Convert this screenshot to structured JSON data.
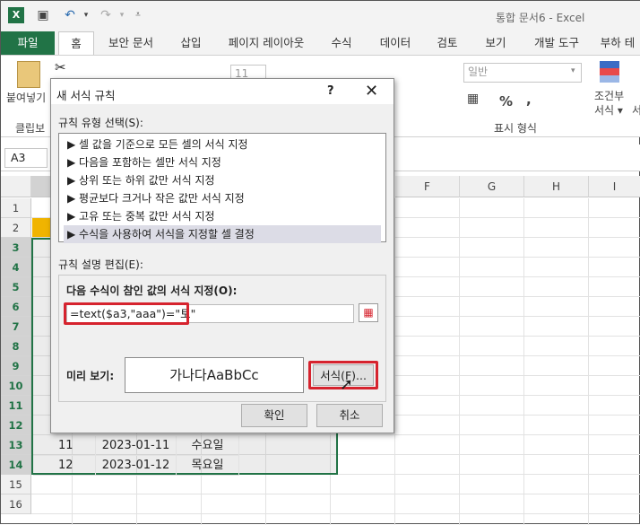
{
  "window": {
    "title": "통합 문서6 - Excel"
  },
  "tabs": [
    "파일",
    "홈",
    "보안 문서",
    "삽입",
    "페이지 레이아웃",
    "수식",
    "데이터",
    "검토",
    "보기",
    "개발 도구",
    "부하 테"
  ],
  "ribbon": {
    "paste_label": "붙여넣기",
    "clipboard_label": "클립보",
    "font_size": "11",
    "number_format": "일반",
    "number_group_label": "표시 형식",
    "conditional_label_1": "조건부",
    "conditional_label_2": "서식 ▾",
    "cell_style_label": "서"
  },
  "formula_bar": {
    "name_box": "A3"
  },
  "columns": [
    "F",
    "G",
    "H",
    "I"
  ],
  "rows": [
    "1",
    "2",
    "3",
    "4",
    "5",
    "6",
    "7",
    "8",
    "9",
    "10",
    "11",
    "12",
    "13",
    "14",
    "15",
    "16"
  ],
  "cells": [
    {
      "num": "11",
      "date": "2023-01-11",
      "day": "수요일"
    },
    {
      "num": "12",
      "date": "2023-01-12",
      "day": "목요일"
    }
  ],
  "dialog": {
    "title": "새 서식 규칙",
    "help": "?",
    "close": "✕",
    "rule_type_label": "규칙 유형 선택(S):",
    "rule_types": [
      "▶ 셀 값을 기준으로 모든 셀의 서식 지정",
      "▶ 다음을 포함하는 셀만 서식 지정",
      "▶ 상위 또는 하위 값만 서식 지정",
      "▶ 평균보다 크거나 작은 값만 서식 지정",
      "▶ 고유 또는 중복 값만 서식 지정",
      "▶ 수식을 사용하여 서식을 지정할 셀 결정"
    ],
    "edit_label": "규칙 설명 편집(E):",
    "formula_label": "다음 수식이 참인 값의 서식 지정(O):",
    "formula_value": "=text($a3,\"aaa\")=\"토\"",
    "preview_label": "미리 보기:",
    "preview_text": "가나다AaBbCc",
    "format_button": "서식(F)...",
    "ok_button": "확인",
    "cancel_button": "취소"
  },
  "colors": {
    "excel_green": "#217346",
    "highlight_red": "#d6232e",
    "header_yellow": "#f0b400"
  }
}
